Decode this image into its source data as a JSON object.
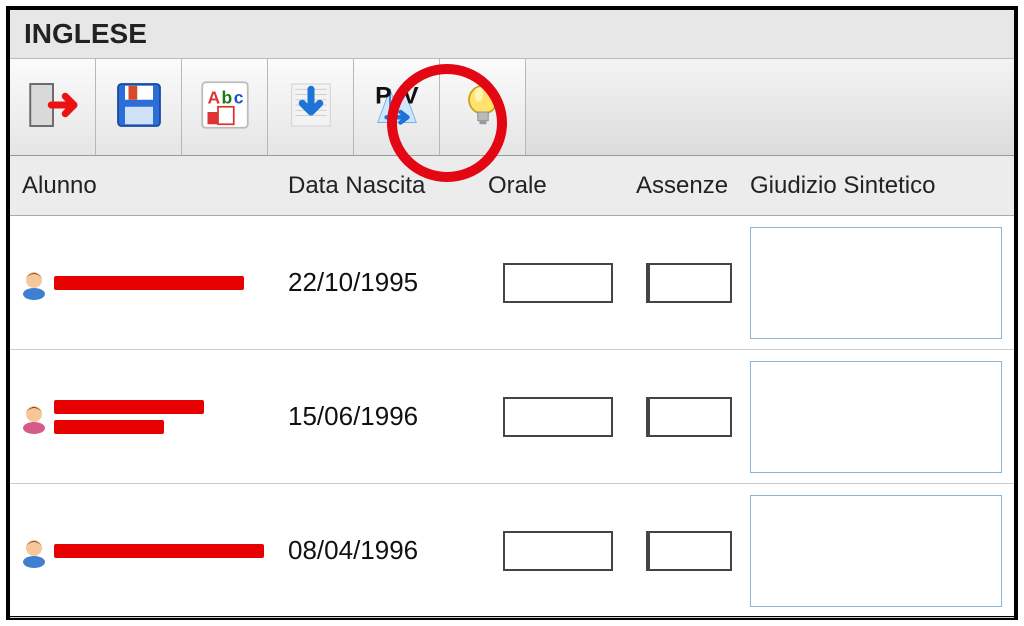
{
  "window": {
    "title": "INGLESE"
  },
  "toolbar": {
    "buttons": [
      {
        "name": "exit-button",
        "icon": "exit-icon"
      },
      {
        "name": "save-button",
        "icon": "save-icon"
      },
      {
        "name": "abc-button",
        "icon": "abc-icon"
      },
      {
        "name": "download-button",
        "icon": "download-icon"
      },
      {
        "name": "proposal-to-vote-button",
        "icon": "pv-icon"
      },
      {
        "name": "hint-button",
        "icon": "lightbulb-icon"
      }
    ]
  },
  "columns": {
    "alunno": "Alunno",
    "data": "Data Nascita",
    "orale": "Orale",
    "assenze": "Assenze",
    "giudizio": "Giudizio Sintetico"
  },
  "rows": [
    {
      "gender": "m",
      "name_redacted_widths": [
        190
      ],
      "dob": "22/10/1995",
      "orale": "",
      "assenze": "",
      "giudizio": ""
    },
    {
      "gender": "f",
      "name_redacted_widths": [
        150,
        110
      ],
      "dob": "15/06/1996",
      "orale": "",
      "assenze": "",
      "giudizio": ""
    },
    {
      "gender": "m",
      "name_redacted_widths": [
        210
      ],
      "dob": "08/04/1996",
      "orale": "",
      "assenze": "",
      "giudizio": ""
    }
  ]
}
